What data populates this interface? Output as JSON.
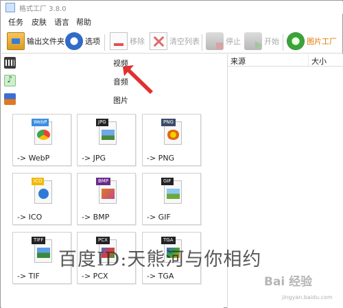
{
  "window": {
    "title": "格式工厂 3.8.0"
  },
  "menu": [
    "任务",
    "皮肤",
    "语言",
    "帮助"
  ],
  "toolbar": {
    "output_folder": "输出文件夹",
    "options": "选项",
    "remove": "移除",
    "clear_list": "清空列表",
    "stop": "停止",
    "start": "开始",
    "image_factory": "图片工厂"
  },
  "categories": [
    "视频",
    "音频",
    "图片"
  ],
  "file_list": {
    "col_source": "来源",
    "col_size": "大小"
  },
  "formats": [
    {
      "tag": "WebP",
      "label": "-> WebP",
      "tag_color": "#3b8ee0"
    },
    {
      "tag": "JPG",
      "label": "-> JPG",
      "tag_color": "#222222"
    },
    {
      "tag": "PNG",
      "label": "-> PNG",
      "tag_color": "#222222"
    },
    {
      "tag": "ICO",
      "label": "-> ICO",
      "tag_color": "#f2b800"
    },
    {
      "tag": "BMP",
      "label": "-> BMP",
      "tag_color": "#6a2a8a"
    },
    {
      "tag": "GIF",
      "label": "-> GIF",
      "tag_color": "#222222"
    },
    {
      "tag": "TIFF",
      "label": "-> TIF",
      "tag_color": "#222222"
    },
    {
      "tag": "PCX",
      "label": "-> PCX",
      "tag_color": "#222222"
    },
    {
      "tag": "TGA",
      "label": "-> TGA",
      "tag_color": "#222222"
    }
  ],
  "watermark": {
    "text": "百度ID:天熊河与你相约",
    "logo": "Bai 经验",
    "url": "jingyan.baidu.com"
  },
  "colors": {
    "accent": "#e07a00",
    "arrow": "#e03030"
  }
}
